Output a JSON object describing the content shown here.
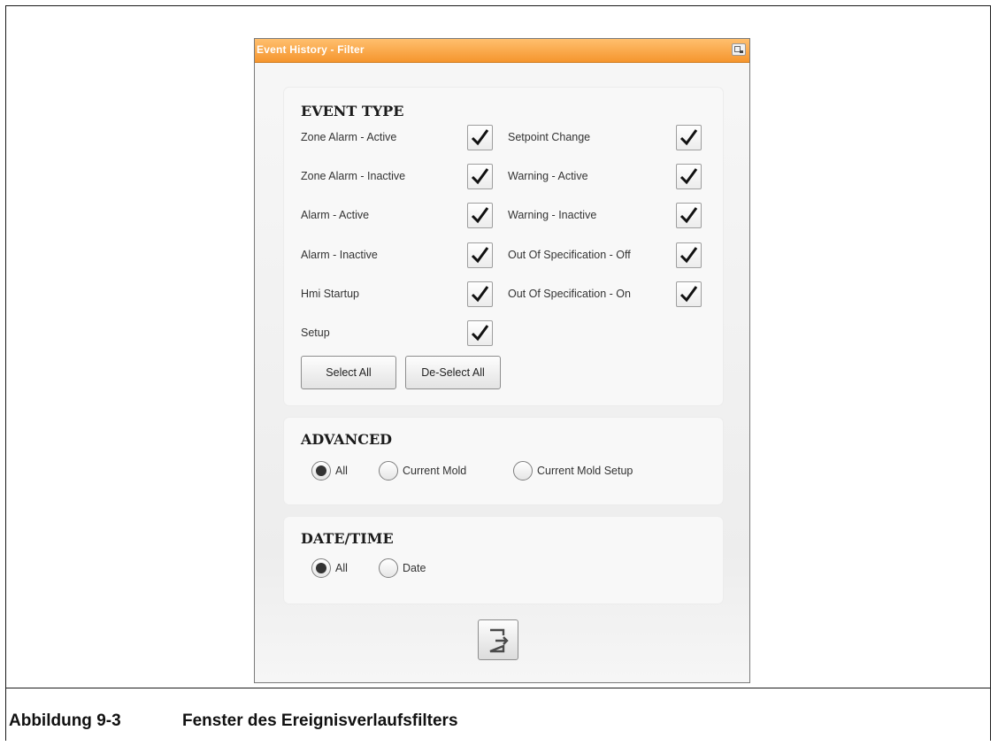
{
  "dialog": {
    "title": "Event History - Filter",
    "minimize_icon": "window-minimize-icon"
  },
  "event_type": {
    "heading": "EVENT TYPE",
    "left_column": [
      {
        "label": "Zone Alarm - Active",
        "checked": true
      },
      {
        "label": "Zone Alarm - Inactive",
        "checked": true
      },
      {
        "label": "Alarm - Active",
        "checked": true
      },
      {
        "label": "Alarm - Inactive",
        "checked": true
      },
      {
        "label": "Hmi Startup",
        "checked": true
      },
      {
        "label": "Setup",
        "checked": true
      }
    ],
    "right_column": [
      {
        "label": "Setpoint Change",
        "checked": true
      },
      {
        "label": "Warning - Active",
        "checked": true
      },
      {
        "label": "Warning - Inactive",
        "checked": true
      },
      {
        "label": "Out Of Specification - Off",
        "checked": true
      },
      {
        "label": "Out Of Specification - On",
        "checked": true
      }
    ],
    "select_all_label": "Select All",
    "deselect_all_label": "De-Select All"
  },
  "advanced": {
    "heading": "ADVANCED",
    "options": [
      "All",
      "Current Mold",
      "Current Mold Setup"
    ],
    "selected": "All"
  },
  "date_time": {
    "heading": "DATE/TIME",
    "options": [
      "All",
      "Date"
    ],
    "selected": "All"
  },
  "exit_icon": "exit-icon",
  "caption": {
    "number": "Abbildung 9-3",
    "text": "Fenster des Ereignisverlaufsfilters"
  },
  "colors": {
    "titlebar": "#f5962e",
    "panel": "#f8f8f8"
  }
}
